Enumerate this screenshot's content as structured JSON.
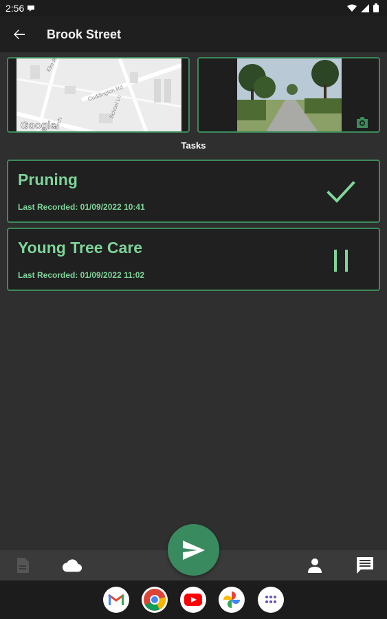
{
  "status_bar": {
    "time": "2:56"
  },
  "app_bar": {
    "title": "Brook Street"
  },
  "images": {
    "map_logo_text": "Google",
    "map_streets": [
      "Elm Rd",
      "Cuddington Rd",
      "School Ln",
      "Birch"
    ]
  },
  "tasks_section": {
    "heading": "Tasks",
    "items": [
      {
        "name": "Pruning",
        "last_recorded": "Last Recorded: 01/09/2022 10:41",
        "status": "complete"
      },
      {
        "name": "Young Tree Care",
        "last_recorded": "Last Recorded: 01/09/2022 11:02",
        "status": "paused"
      }
    ]
  },
  "colors": {
    "accent_green": "#7fd49a",
    "card_border": "#3d8a5a",
    "fab": "#3a8a5f",
    "background": "#2f2f2f"
  },
  "bottom_nav": {
    "icons": [
      "document-icon",
      "cloud-icon",
      "person-icon",
      "message-icon"
    ]
  },
  "fab": {
    "icon": "send-icon"
  },
  "dock_apps": [
    "gmail-icon",
    "chrome-icon",
    "youtube-icon",
    "photos-icon",
    "app-drawer-icon"
  ]
}
